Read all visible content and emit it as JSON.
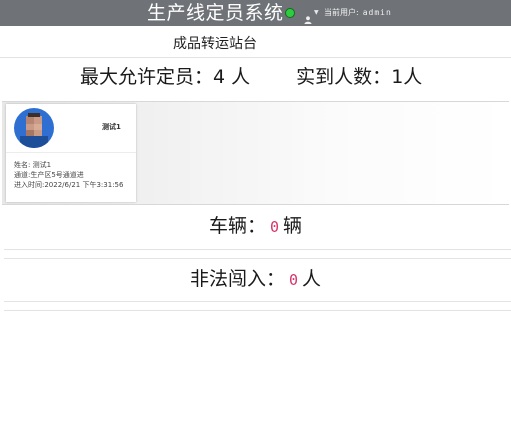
{
  "header": {
    "title": "生产线定员系统",
    "status_color": "#2ecc40",
    "user_prefix": "当前用户:",
    "user_name": "admin",
    "user_icon": "user-icon",
    "dropdown_icon": "caret-down-icon"
  },
  "station": {
    "name": "成品转运站台"
  },
  "capacity": {
    "max_label": "最大允许定员：",
    "max_value": "4",
    "max_unit": "人",
    "actual_label": "实到人数：",
    "actual_value": "1",
    "actual_unit": "人"
  },
  "personnel": [
    {
      "name": "测试1",
      "info_name": "姓名: 测试1",
      "info_channel": "通道:生产区5号通道进",
      "info_time": "进入时间:2022/6/21 下午3:31:56"
    }
  ],
  "vehicles": {
    "label": "车辆：",
    "value": "0",
    "unit": "辆"
  },
  "intrusions": {
    "label": "非法闯入：",
    "value": "0",
    "unit": "人"
  },
  "colors": {
    "header_bg": "#6f7377",
    "count_highlight": "#d6336c"
  }
}
